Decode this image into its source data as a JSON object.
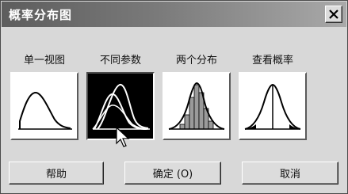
{
  "window": {
    "title": "概率分布图"
  },
  "options": [
    {
      "label": "单一视图"
    },
    {
      "label": "不同参数"
    },
    {
      "label": "两个分布"
    },
    {
      "label": "查看概率"
    }
  ],
  "buttons": {
    "help": "帮助",
    "ok": "确定 (O)",
    "cancel": "取消"
  },
  "icons": {
    "close": "close-icon",
    "cursor": "mouse-pointer-icon"
  }
}
